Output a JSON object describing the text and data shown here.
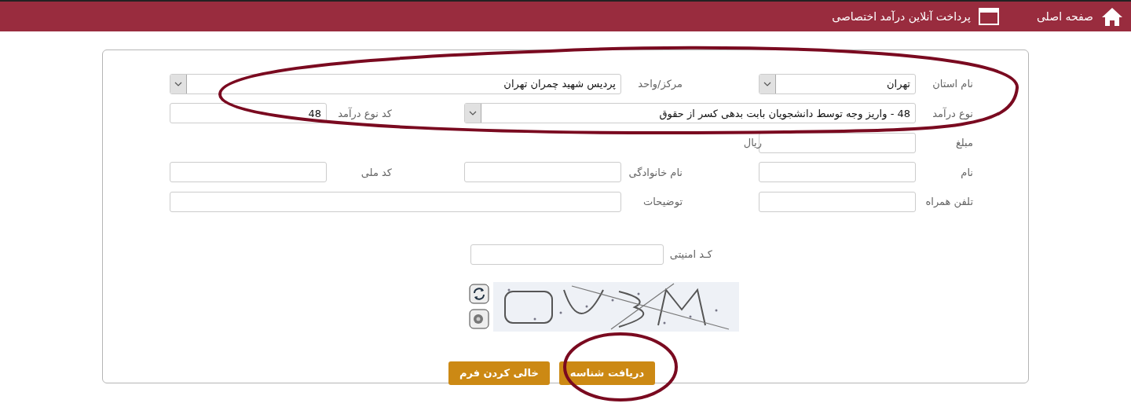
{
  "header": {
    "items": [
      {
        "label": "صفحه اصلی"
      },
      {
        "label": "پرداخت آنلاین درآمد اختصاصی"
      }
    ]
  },
  "form": {
    "fields": [
      {
        "kind": "select",
        "label": "نام استان",
        "value": "تهران"
      },
      {
        "kind": "select",
        "label": "مرکز/واحد",
        "value": "پردیس شهید چمران تهران"
      },
      {
        "kind": "select",
        "label": "نوع درآمد",
        "value": "48 - واریز وجه توسط دانشجویان بابت بدهی کسر از حقوق"
      },
      {
        "kind": "input",
        "label": "کد نوع درآمد",
        "value": "48"
      },
      {
        "kind": "input",
        "label": "مبلغ",
        "unit": "ریال"
      },
      {
        "kind": "input",
        "label": "نام"
      },
      {
        "kind": "input",
        "label": "نام خانوادگی"
      },
      {
        "kind": "input",
        "label": "کد ملی"
      },
      {
        "kind": "input",
        "label": "تلفن همراه"
      },
      {
        "kind": "input",
        "label": "توضیحات"
      }
    ],
    "security": {
      "label": "کـد امنیتی"
    },
    "buttons": [
      {
        "label": "دریافت شناسه"
      },
      {
        "label": "خالی کردن فرم"
      }
    ]
  }
}
